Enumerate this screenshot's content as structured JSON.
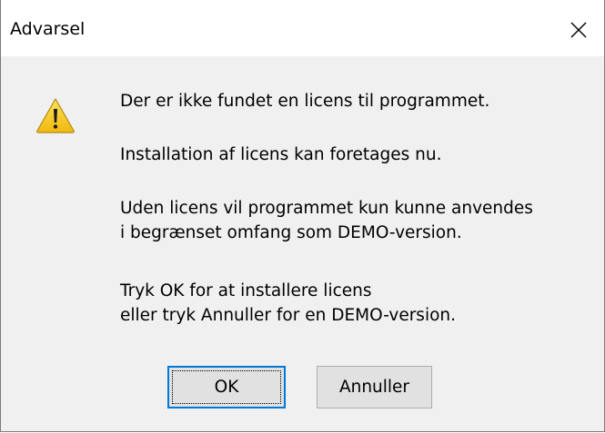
{
  "window": {
    "title": "Advarsel"
  },
  "message": {
    "line1": "Der er ikke fundet en licens til programmet.",
    "line2": "Installation af licens kan foretages nu.",
    "line3a": "Uden licens vil programmet kun kunne anvendes",
    "line3b": "i begrænset omfang som DEMO-version.",
    "line4a": "Tryk OK for at installere licens",
    "line4b": "eller tryk Annuller for en DEMO-version."
  },
  "buttons": {
    "ok_label": "OK",
    "cancel_label": "Annuller"
  },
  "icons": {
    "warning": "warning-icon",
    "close": "close-icon"
  },
  "colors": {
    "dialog_background": "#f0f0f0",
    "titlebar_background": "#ffffff",
    "default_button_border": "#0078d7",
    "warning_fill": "#f8d01c"
  }
}
